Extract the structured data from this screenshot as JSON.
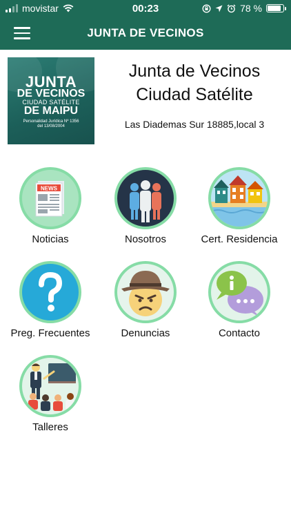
{
  "status": {
    "carrier": "movistar",
    "time": "00:23",
    "battery": "78 %",
    "battery_level": 0.78
  },
  "nav": {
    "title": "JUNTA DE VECINOS",
    "menu_icon": "hamburger-menu-icon"
  },
  "header": {
    "title_line1": "Junta de Vecinos",
    "title_line2": "Ciudad Satélite",
    "address": "Las Diademas Sur 18885,local 3",
    "logo": {
      "line1": "JUNTA",
      "line2": "DE VECINOS",
      "line3": "CIUDAD SATÉLITE",
      "line4": "DE MAIPU",
      "line5a": "Personalidad Jurídica Nº 1356",
      "line5b": "del 13/08/2004"
    }
  },
  "menu": [
    {
      "label": "Noticias",
      "icon": "newspaper-icon"
    },
    {
      "label": "Nosotros",
      "icon": "people-group-icon"
    },
    {
      "label": "Cert. Residencia",
      "icon": "houses-icon"
    },
    {
      "label": "Preg. Frecuentes",
      "icon": "question-mark-icon"
    },
    {
      "label": "Denuncias",
      "icon": "angry-detective-icon"
    },
    {
      "label": "Contacto",
      "icon": "chat-bubbles-icon"
    },
    {
      "label": "Talleres",
      "icon": "classroom-teacher-icon"
    }
  ],
  "colors": {
    "primary": "#1e6b57",
    "circle_border": "#86dca6"
  }
}
